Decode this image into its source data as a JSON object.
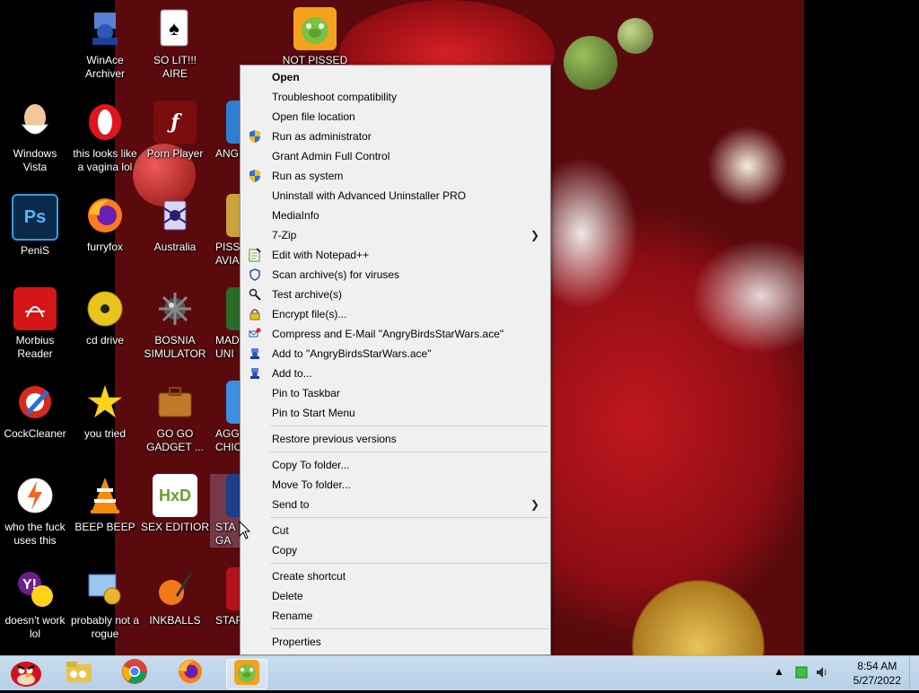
{
  "desktop_icons": [
    {
      "label": "WinAce Archiver",
      "icon": "winace-icon"
    },
    {
      "label": "SO LIT!!! AIRE",
      "icon": "solitaire-icon"
    },
    {
      "label": "NOT PISSED",
      "icon": "angry-birds-pig-icon"
    },
    {
      "label": "Windows Vista",
      "icon": "egg-icon"
    },
    {
      "label": "this looks like a vagina lol",
      "icon": "opera-icon"
    },
    {
      "label": "Porn Player",
      "icon": "flash-player-icon"
    },
    {
      "label": "ANGRY",
      "icon": "angry-birds-icon"
    },
    {
      "label": "PeniS",
      "icon": "photoshop-icon"
    },
    {
      "label": "furryfox",
      "icon": "firefox-icon"
    },
    {
      "label": "Australia",
      "icon": "spider-solitaire-icon"
    },
    {
      "label": "PISSED AVIA",
      "icon": "game-icon"
    },
    {
      "label": "Morbius Reader",
      "icon": "acrobat-reader-icon"
    },
    {
      "label": "cd drive",
      "icon": "cd-drive-icon"
    },
    {
      "label": "BOSNIA SIMULATOR",
      "icon": "minesweeper-icon"
    },
    {
      "label": "MAD UNI",
      "icon": "game-icon"
    },
    {
      "label": "CockCleaner",
      "icon": "ccleaner-icon"
    },
    {
      "label": "you tried",
      "icon": "star-icon"
    },
    {
      "label": "GO GO GADGET ...",
      "icon": "briefcase-icon"
    },
    {
      "label": "AGG CHIC",
      "icon": "game-icon"
    },
    {
      "label": "who the fuck uses this",
      "icon": "avast-icon"
    },
    {
      "label": "BEEP BEEP",
      "icon": "vlc-icon"
    },
    {
      "label": "SEX EDITIOR",
      "icon": "hxd-icon"
    },
    {
      "label": "STA GA",
      "icon": "game-icon"
    },
    {
      "label": "doesn't work lol",
      "icon": "yahoo-messenger-icon"
    },
    {
      "label": "probably not a rogue",
      "icon": "control-panel-icon"
    },
    {
      "label": "INKBALLS",
      "icon": "inkball-icon"
    },
    {
      "label": "STAR",
      "icon": "game-icon"
    }
  ],
  "context_menu": {
    "items": [
      {
        "label": "Open"
      },
      {
        "label": "Troubleshoot compatibility"
      },
      {
        "label": "Open file location"
      },
      {
        "label": "Run as administrator",
        "icon": "uac-shield-icon"
      },
      {
        "label": "Grant Admin Full Control"
      },
      {
        "label": "Run as system",
        "icon": "uac-shield-icon"
      },
      {
        "label": "Uninstall with Advanced Uninstaller PRO"
      },
      {
        "label": "MediaInfo"
      },
      {
        "label": "7-Zip"
      },
      {
        "label": "Edit with Notepad++",
        "icon": "notepad-plus-plus-icon"
      },
      {
        "label": "Scan archive(s) for viruses",
        "icon": "shield-scan-icon"
      },
      {
        "label": "Test archive(s)",
        "icon": "magnifier-icon"
      },
      {
        "label": "Encrypt file(s)...",
        "icon": "lock-icon"
      },
      {
        "label": "Compress and E-Mail \"AngryBirdsStarWars.ace\"",
        "icon": "compress-email-icon"
      },
      {
        "label": "Add to \"AngryBirdsStarWars.ace\"",
        "icon": "winace-small-icon"
      },
      {
        "label": "Add to...",
        "icon": "winace-small-icon"
      },
      {
        "label": "Pin to Taskbar"
      },
      {
        "label": "Pin to Start Menu"
      },
      {
        "label": "Restore previous versions"
      },
      {
        "label": "Copy To folder..."
      },
      {
        "label": "Move To folder..."
      },
      {
        "label": "Send to"
      },
      {
        "label": "Cut"
      },
      {
        "label": "Copy"
      },
      {
        "label": "Create shortcut"
      },
      {
        "label": "Delete"
      },
      {
        "label": "Rename"
      },
      {
        "label": "Properties"
      }
    ]
  },
  "taskbar": {
    "start_icon": "angry-bird-start-orb-icon",
    "pinned": [
      {
        "name": "file-explorer-icon"
      },
      {
        "name": "chrome-icon"
      },
      {
        "name": "firefox-icon"
      },
      {
        "name": "angry-birds-pig-icon"
      }
    ],
    "clock_time": "8:54 AM",
    "clock_date": "5/27/2022"
  }
}
